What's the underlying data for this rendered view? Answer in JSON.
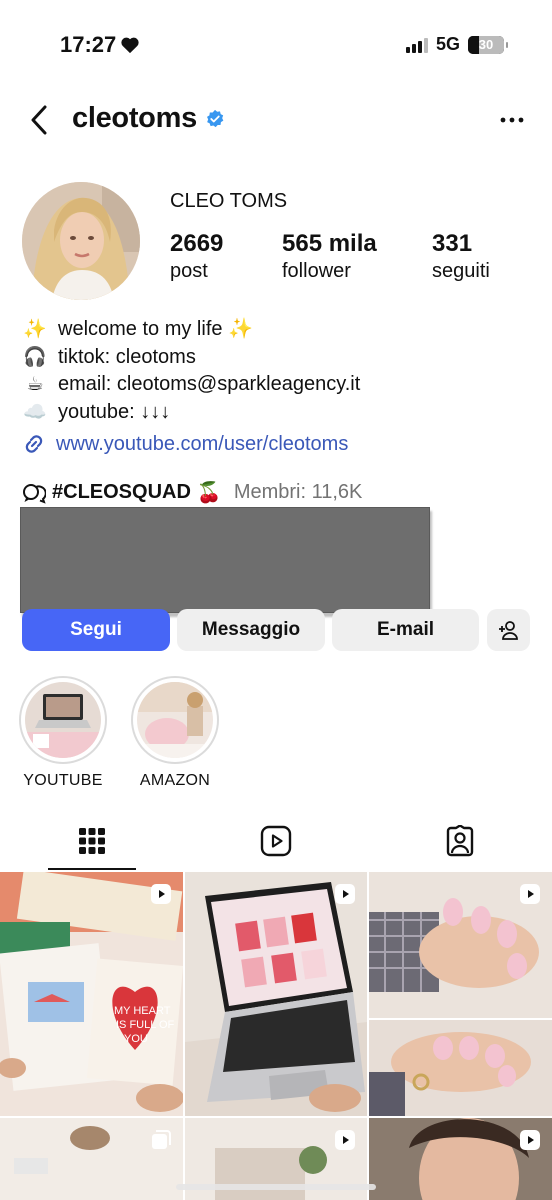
{
  "status_bar": {
    "time": "17:27",
    "network": "5G",
    "battery_level": "30"
  },
  "header": {
    "username": "cleotoms",
    "verified_icon": "verified-badge-icon",
    "more_icon": "more-horizontal-icon",
    "back_icon": "chevron-left-icon"
  },
  "profile": {
    "full_name": "CLEO TOMS",
    "stats": [
      {
        "value": "2669",
        "label": "post"
      },
      {
        "value": "565 mila",
        "label": "follower"
      },
      {
        "value": "331",
        "label": "seguiti"
      }
    ]
  },
  "bio": {
    "lines": [
      {
        "icon": "✨",
        "text": "welcome to my life ✨"
      },
      {
        "icon": "🎧",
        "text": "tiktok: cleotoms"
      },
      {
        "icon": "☕",
        "text": "email: cleotoms@sparkleagency.it"
      },
      {
        "icon": "☁️",
        "text": "youtube: ↓↓↓"
      }
    ],
    "link": "www.youtube.com/user/cleotoms"
  },
  "community": {
    "tag": "#CLEOSQUAD",
    "emoji": "🍒",
    "members": "Membri: 11,6K"
  },
  "buttons": {
    "follow": "Segui",
    "message": "Messaggio",
    "email": "E-mail"
  },
  "highlights": [
    {
      "label": "YOUTUBE"
    },
    {
      "label": "AMAZON"
    }
  ],
  "tabs": [
    "grid-icon",
    "reels-icon",
    "tagged-icon"
  ],
  "colors": {
    "accent": "#4766f6",
    "link": "#3a58b8",
    "verified": "#3897f0"
  }
}
